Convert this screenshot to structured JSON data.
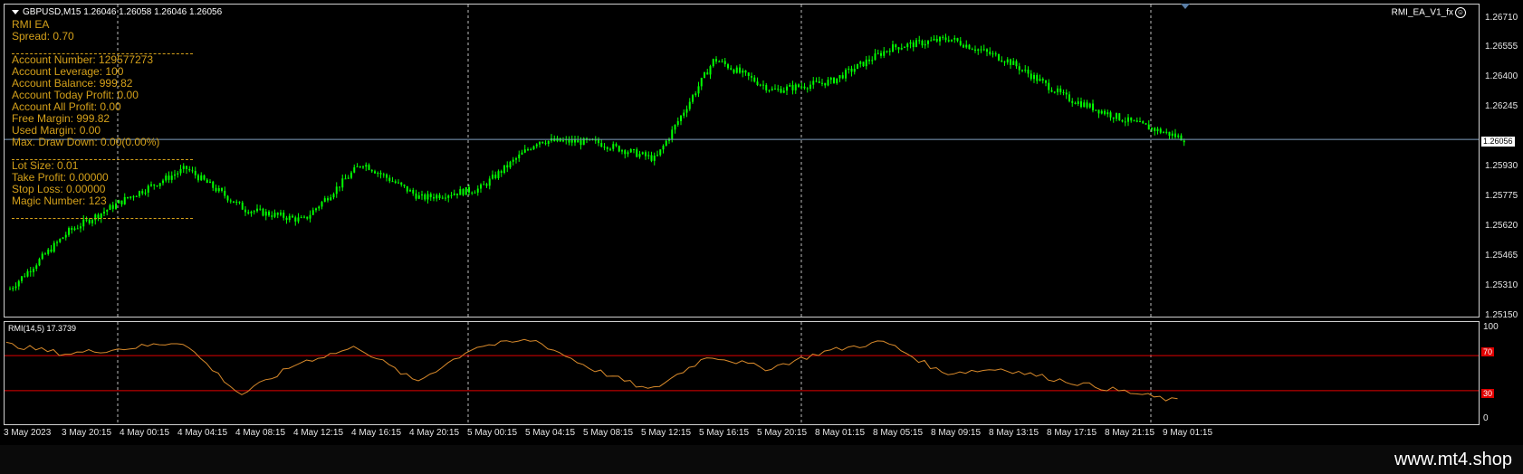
{
  "chart": {
    "symbol_line": "GBPUSD,M15  1.26046 1.26058 1.26046 1.26056",
    "ea_name": "RMI_EA_V1_fx",
    "ea_icon": "smiley-icon",
    "current_price": "1.26056",
    "colors": {
      "candle": "#00ff00",
      "background": "#000000",
      "info_text": "#d4a01a",
      "rmi_line": "#d98a2b",
      "level_line": "#e00000",
      "bid_line": "#7f9fbf"
    }
  },
  "info_panel": {
    "title": "RMI EA",
    "spread": "Spread: 0.70",
    "account_number": "Account Number: 129577273",
    "account_leverage": "Account Leverage: 100",
    "account_balance": "Account Balance: 999.82",
    "today_profit": "Account Today Profit: 0.00",
    "all_profit": "Account All Profit: 0.00",
    "free_margin": "Free Margin: 999.82",
    "used_margin": "Used Margin: 0.00",
    "max_drawdown": "Max. Draw Down: 0.00(0.00%)",
    "lot_size": "Lot Size: 0.01",
    "take_profit": "Take Profit: 0.00000",
    "stop_loss": "Stop Loss: 0.00000",
    "magic_number": "Magic Number: 123"
  },
  "price_scale": [
    "1.26710",
    "1.26555",
    "1.26400",
    "1.26245",
    "1.25930",
    "1.25775",
    "1.25620",
    "1.25465",
    "1.25310",
    "1.25150"
  ],
  "indicator": {
    "title": "RMI(14,5) 17.3739",
    "scale": [
      "100",
      "70",
      "30",
      "0"
    ],
    "levels": [
      "70",
      "30"
    ]
  },
  "time_axis": [
    "3 May 2023",
    "3 May 20:15",
    "4 May 00:15",
    "4 May 04:15",
    "4 May 08:15",
    "4 May 12:15",
    "4 May 16:15",
    "4 May 20:15",
    "5 May 00:15",
    "5 May 04:15",
    "5 May 08:15",
    "5 May 12:15",
    "5 May 16:15",
    "5 May 20:15",
    "8 May 01:15",
    "8 May 05:15",
    "8 May 09:15",
    "8 May 13:15",
    "8 May 17:15",
    "8 May 21:15",
    "9 May 01:15"
  ],
  "chart_data": {
    "type": "candlestick",
    "x": [
      "3 May 2023",
      "3 May 20:15",
      "4 May 00:15",
      "4 May 04:15",
      "4 May 08:15",
      "4 May 12:15",
      "4 May 16:15",
      "4 May 20:15",
      "5 May 00:15",
      "5 May 04:15",
      "5 May 08:15",
      "5 May 12:15",
      "5 May 16:15",
      "5 May 20:15",
      "8 May 01:15",
      "8 May 05:15",
      "8 May 09:15",
      "8 May 13:15",
      "8 May 17:15",
      "8 May 21:15",
      "9 May 01:15"
    ],
    "close": [
      1.2525,
      1.2556,
      1.2574,
      1.259,
      1.2568,
      1.2562,
      1.2593,
      1.2574,
      1.2579,
      1.2605,
      1.2604,
      1.2595,
      1.2649,
      1.2632,
      1.2637,
      1.2655,
      1.266,
      1.2648,
      1.2628,
      1.2616,
      1.2606
    ],
    "ylim": [
      1.2515,
      1.2671
    ],
    "rmi": [
      83,
      72,
      78,
      86,
      25,
      62,
      80,
      40,
      80,
      88,
      55,
      30,
      70,
      55,
      75,
      86,
      50,
      55,
      42,
      30,
      18
    ],
    "rmi_ylim": [
      0,
      100
    ],
    "rmi_levels": [
      70,
      30
    ]
  },
  "watermark": "www.mt4.shop"
}
